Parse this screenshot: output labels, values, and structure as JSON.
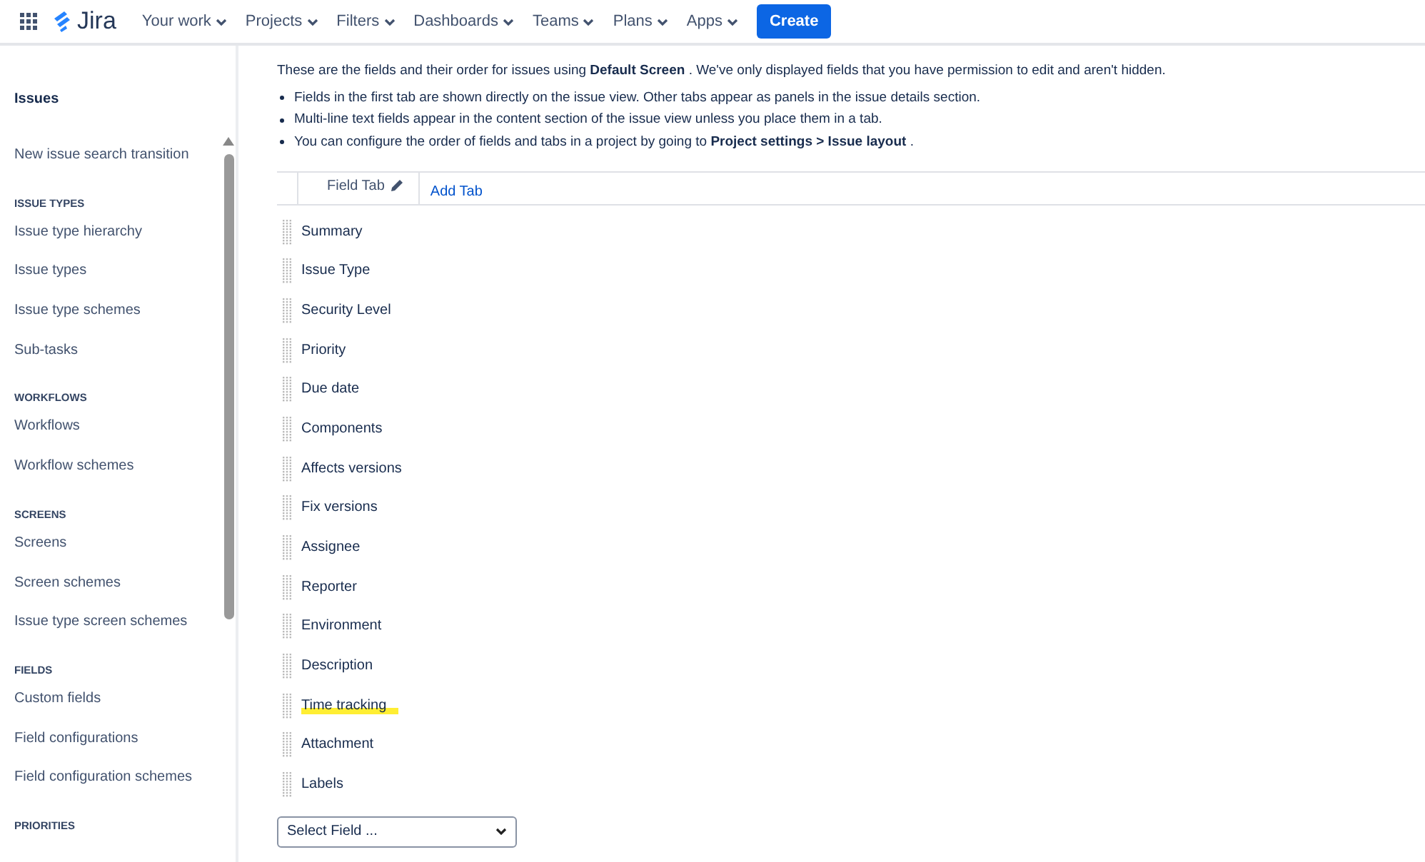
{
  "topbar": {
    "app_name": "Jira",
    "menus": [
      {
        "label": "Your work"
      },
      {
        "label": "Projects"
      },
      {
        "label": "Filters"
      },
      {
        "label": "Dashboards"
      },
      {
        "label": "Teams"
      },
      {
        "label": "Plans"
      },
      {
        "label": "Apps"
      }
    ],
    "create_button": "Create"
  },
  "sidebar": {
    "title": "Issues",
    "items": [
      {
        "kind": "link",
        "label": "New issue search transition"
      },
      {
        "kind": "heading",
        "label": "ISSUE TYPES"
      },
      {
        "kind": "link",
        "label": "Issue type hierarchy"
      },
      {
        "kind": "link",
        "label": "Issue types"
      },
      {
        "kind": "link",
        "label": "Issue type schemes"
      },
      {
        "kind": "link",
        "label": "Sub-tasks"
      },
      {
        "kind": "heading",
        "label": "WORKFLOWS"
      },
      {
        "kind": "link",
        "label": "Workflows"
      },
      {
        "kind": "link",
        "label": "Workflow schemes"
      },
      {
        "kind": "heading",
        "label": "SCREENS"
      },
      {
        "kind": "link",
        "label": "Screens"
      },
      {
        "kind": "link",
        "label": "Screen schemes"
      },
      {
        "kind": "link",
        "label": "Issue type screen schemes"
      },
      {
        "kind": "heading",
        "label": "FIELDS"
      },
      {
        "kind": "link",
        "label": "Custom fields"
      },
      {
        "kind": "link",
        "label": "Field configurations"
      },
      {
        "kind": "link",
        "label": "Field configuration schemes"
      },
      {
        "kind": "heading",
        "label": "PRIORITIES"
      }
    ]
  },
  "intro": "These are the fields and their order for issues using **Default Screen** . We've only displayed fields that you have permission to edit and aren't hidden.",
  "bullets": [
    "Fields in the first tab are shown directly on the issue view. Other tabs appear as panels in the issue details section.",
    "Multi-line text fields appear in the content section of the issue view unless you place them in a tab.",
    "You can configure the order of fields and tabs in a project by going to **Project settings > Issue layout** ."
  ],
  "tabs": [
    {
      "label": "Field Tab",
      "selected": true
    },
    {
      "label": "Add Tab",
      "selected": false
    }
  ],
  "fields": [
    {
      "label": "Summary",
      "highlighted": false
    },
    {
      "label": "Issue Type",
      "highlighted": false
    },
    {
      "label": "Security Level",
      "highlighted": false
    },
    {
      "label": "Priority",
      "highlighted": false
    },
    {
      "label": "Due date",
      "highlighted": false
    },
    {
      "label": "Components",
      "highlighted": false
    },
    {
      "label": "Affects versions",
      "highlighted": false
    },
    {
      "label": "Fix versions",
      "highlighted": false
    },
    {
      "label": "Assignee",
      "highlighted": false
    },
    {
      "label": "Reporter",
      "highlighted": false
    },
    {
      "label": "Environment",
      "highlighted": false
    },
    {
      "label": "Description",
      "highlighted": false
    },
    {
      "label": "Time tracking",
      "highlighted": true
    },
    {
      "label": "Attachment",
      "highlighted": false
    },
    {
      "label": "Labels",
      "highlighted": false
    }
  ],
  "select_field": {
    "value": "Select Field ..."
  }
}
